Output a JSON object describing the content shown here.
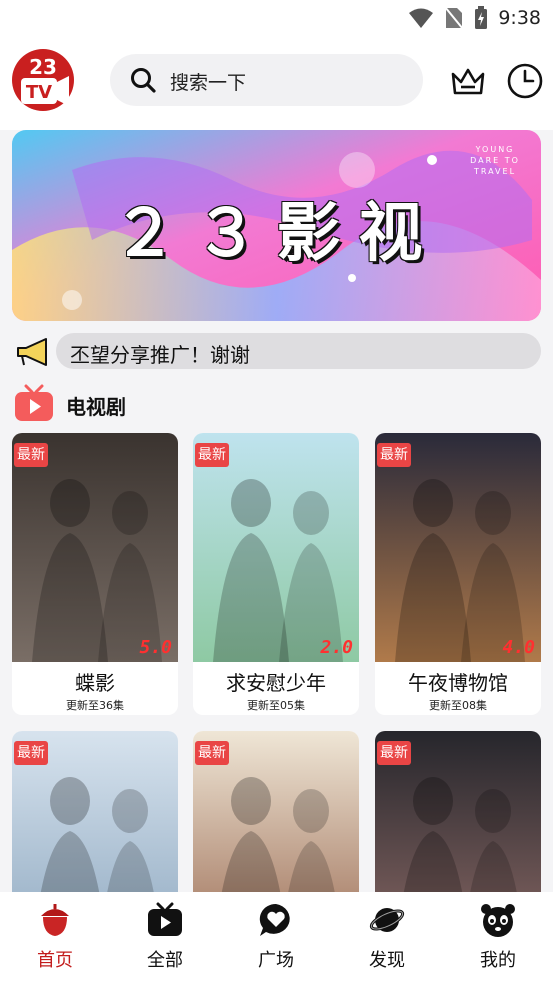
{
  "status_bar": {
    "time": "9:38"
  },
  "logo": {
    "text_top": "23",
    "text_bottom": "TV"
  },
  "search": {
    "placeholder": "搜索一下"
  },
  "banner": {
    "title": "２３影视",
    "tagline": "YOUNG DARE TO TRAVEL"
  },
  "notice": {
    "text": "丕望分享推广！谢谢"
  },
  "section": {
    "title": "电视剧"
  },
  "cards": [
    {
      "badge": "最新",
      "title": "蝶影",
      "subtitle": "更新至36集",
      "score": "5.0",
      "colors": [
        "#3a332f",
        "#7a6e66"
      ]
    },
    {
      "badge": "最新",
      "title": "求安慰少年",
      "subtitle": "更新至05集",
      "score": "2.0",
      "colors": [
        "#bfe3ee",
        "#8ec9a3"
      ]
    },
    {
      "badge": "最新",
      "title": "午夜博物馆",
      "subtitle": "更新至08集",
      "score": "4.0",
      "colors": [
        "#2a2a3a",
        "#b07a4a"
      ]
    },
    {
      "badge": "最新",
      "title": "",
      "subtitle": "",
      "score": "",
      "colors": [
        "#d7e3ee",
        "#8ea8c0"
      ]
    },
    {
      "badge": "最新",
      "title": "",
      "subtitle": "",
      "score": "",
      "colors": [
        "#efe6d6",
        "#9a6a52"
      ]
    },
    {
      "badge": "最新",
      "title": "",
      "subtitle": "",
      "score": "",
      "colors": [
        "#26262c",
        "#8c6a66"
      ]
    }
  ],
  "tabs": [
    {
      "label": "首页",
      "icon": "home-acorn-icon",
      "active": true
    },
    {
      "label": "全部",
      "icon": "tv-play-icon",
      "active": false
    },
    {
      "label": "广场",
      "icon": "heart-bubble-icon",
      "active": false
    },
    {
      "label": "发现",
      "icon": "planet-icon",
      "active": false
    },
    {
      "label": "我的",
      "icon": "panda-icon",
      "active": false
    }
  ],
  "colors": {
    "accent": "#c21d1d",
    "badge": "#e94545",
    "tv_icon": "#f45c5c"
  }
}
